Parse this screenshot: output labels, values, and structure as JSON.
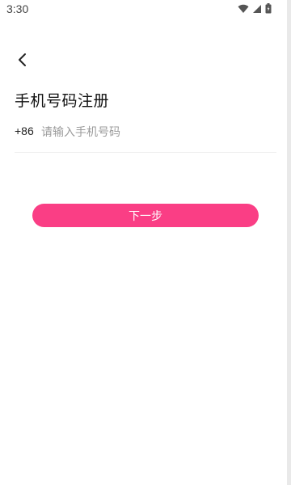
{
  "status_bar": {
    "time": "3:30",
    "icons": [
      "wifi-icon",
      "signal-icon",
      "battery-icon"
    ]
  },
  "header": {
    "back_icon": "chevron-left-icon"
  },
  "title": "手机号码注册",
  "phone_field": {
    "country_code": "+86",
    "value": "",
    "placeholder": "请输入手机号码"
  },
  "next_button": {
    "label": "下一步",
    "color": "#fa3e85"
  }
}
